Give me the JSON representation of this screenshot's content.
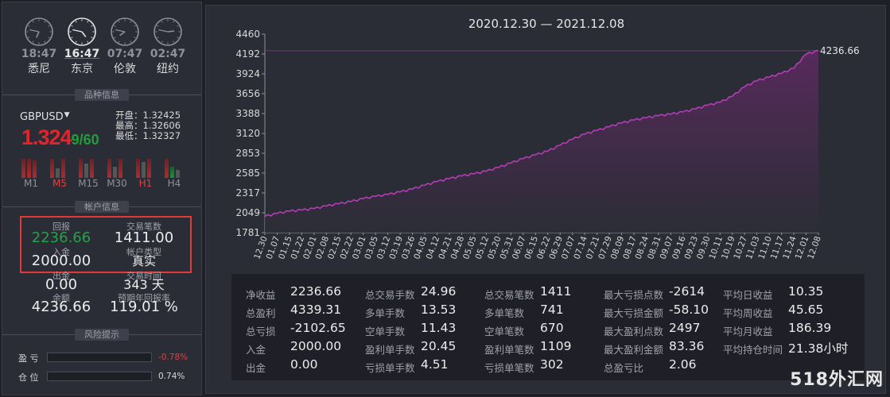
{
  "clocks": [
    {
      "time": "18:47",
      "city": "悉尼",
      "active": false,
      "hour": 18,
      "minute": 47
    },
    {
      "time": "16:47",
      "city": "东京",
      "active": true,
      "hour": 16,
      "minute": 47
    },
    {
      "time": "07:47",
      "city": "伦敦",
      "active": false,
      "hour": 7,
      "minute": 47
    },
    {
      "time": "02:47",
      "city": "纽约",
      "active": false,
      "hour": 2,
      "minute": 47
    }
  ],
  "symbol_section": {
    "title": "品种信息",
    "symbol": "GBPUSD",
    "price_main": "1.324",
    "price_tail": "9/60",
    "open": "开盘：1.32425",
    "high": "最高：1.32606",
    "low": "最低：1.32327"
  },
  "timeframes": [
    {
      "label": "M1",
      "red": false
    },
    {
      "label": "M5",
      "red": true
    },
    {
      "label": "M15",
      "red": false
    },
    {
      "label": "M30",
      "red": false
    },
    {
      "label": "H1",
      "red": true
    },
    {
      "label": "H4",
      "red": false
    }
  ],
  "account_section": {
    "title": "帐户信息",
    "return_label": "回报",
    "return_value": "2236.66",
    "trades_label": "交易笔数",
    "trades_value": "1411.00",
    "deposit_label": "入金",
    "deposit_value": "2000.00",
    "type_label": "帐户类型",
    "type_value": "真实",
    "withdraw_label": "出金",
    "withdraw_value": "0.00",
    "time_label": "交易时间",
    "time_value": "343 天",
    "balance_label": "余额",
    "balance_value": "4236.66",
    "annual_label": "预期年回报率",
    "annual_value": "119.01 %"
  },
  "risk_section": {
    "title": "风险提示",
    "profit_label": "盈  亏",
    "profit_value": "-0.78%",
    "position_label": "仓  位",
    "position_value": "0.74%"
  },
  "chart_data": {
    "type": "area",
    "title": "2020.12.30 — 2021.12.08",
    "y_ticks": [
      "4460",
      "4192",
      "3924",
      "3656",
      "3388",
      "3120",
      "2853",
      "2585",
      "2317",
      "2049",
      "1781"
    ],
    "ylim": [
      1781,
      4460
    ],
    "x_labels": [
      "12.30",
      "01.07",
      "01.15",
      "01.22",
      "02.01",
      "02.08",
      "02.15",
      "02.22",
      "03.01",
      "03.05",
      "03.12",
      "03.19",
      "03.26",
      "04.05",
      "04.12",
      "04.21",
      "04.28",
      "05.05",
      "05.12",
      "05.20",
      "05.31",
      "06.07",
      "06.15",
      "06.22",
      "06.29",
      "07.07",
      "07.14",
      "07.21",
      "07.29",
      "08.09",
      "08.17",
      "08.24",
      "08.31",
      "09.07",
      "09.16",
      "09.23",
      "09.30",
      "10.11",
      "10.19",
      "10.27",
      "11.03",
      "11.10",
      "11.17",
      "11.24",
      "12.01",
      "12.08"
    ],
    "values": [
      2000,
      2040,
      2070,
      2085,
      2105,
      2140,
      2170,
      2200,
      2240,
      2270,
      2295,
      2330,
      2370,
      2420,
      2470,
      2510,
      2545,
      2575,
      2610,
      2660,
      2720,
      2780,
      2830,
      2880,
      2960,
      3040,
      3110,
      3160,
      3210,
      3260,
      3300,
      3330,
      3360,
      3380,
      3410,
      3450,
      3500,
      3540,
      3620,
      3750,
      3830,
      3880,
      3930,
      4000,
      4190,
      4236.66
    ],
    "last_label": "4236.66",
    "line_color": "#b43cb4",
    "fill_color": "#5a2a5e"
  },
  "stats": [
    [
      {
        "label": "净收益",
        "value": "2236.66"
      },
      {
        "label": "总盈利",
        "value": "4339.31"
      },
      {
        "label": "总亏损",
        "value": "-2102.65"
      },
      {
        "label": "入金",
        "value": "2000.00"
      },
      {
        "label": "出金",
        "value": "0.00"
      }
    ],
    [
      {
        "label": "总交易手数",
        "value": "24.96"
      },
      {
        "label": "多单手数",
        "value": "13.53"
      },
      {
        "label": "空单手数",
        "value": "11.43"
      },
      {
        "label": "盈利单手数",
        "value": "20.45"
      },
      {
        "label": "亏损单手数",
        "value": "4.51"
      }
    ],
    [
      {
        "label": "总交易笔数",
        "value": "1411"
      },
      {
        "label": "多单笔数",
        "value": "741"
      },
      {
        "label": "空单笔数",
        "value": "670"
      },
      {
        "label": "盈利单笔数",
        "value": "1109"
      },
      {
        "label": "亏损单笔数",
        "value": "302"
      }
    ],
    [
      {
        "label": "最大亏损点数",
        "value": "-2614"
      },
      {
        "label": "最大亏损金额",
        "value": "-58.10"
      },
      {
        "label": "最大盈利点数",
        "value": "2497"
      },
      {
        "label": "最大盈利金额",
        "value": "83.36"
      },
      {
        "label": "总盈亏比",
        "value": "2.06"
      }
    ],
    [
      {
        "label": "平均日收益",
        "value": "10.35"
      },
      {
        "label": "平均周收益",
        "value": "45.65"
      },
      {
        "label": "平均月收益",
        "value": "186.39"
      },
      {
        "label": "平均持仓时间",
        "value": "21.38小时"
      }
    ]
  ],
  "watermark": "518外汇网"
}
